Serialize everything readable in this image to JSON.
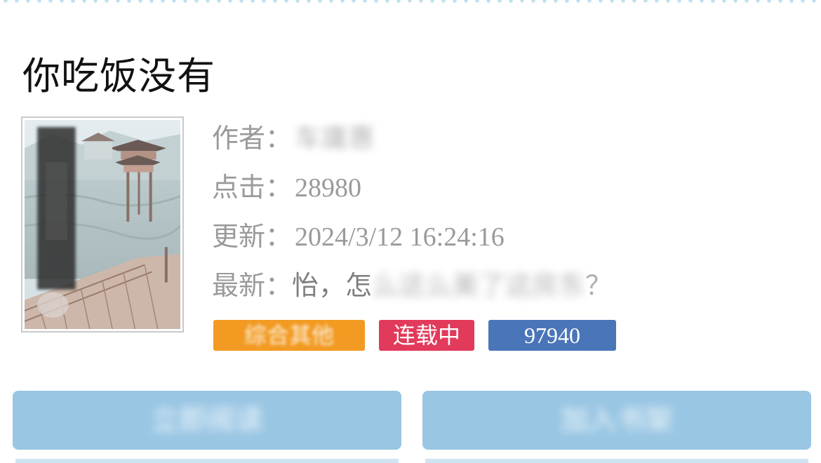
{
  "book": {
    "title": "你吃饭没有",
    "author_label": "作者：",
    "author_value": "车庸惠",
    "clicks_label": "点击：",
    "clicks_value": "28980",
    "updated_label": "更新：",
    "updated_value": "2024/3/12 16:24:16",
    "latest_label": "最新：",
    "latest_value_visible": "怡，怎",
    "latest_value_obscured": "么这么美了这房东",
    "latest_value_end": "？"
  },
  "tags": {
    "category": "综合其他",
    "status": "连载中",
    "word_count": "97940"
  },
  "actions": {
    "read_label": "立即阅读",
    "shelf_label": "加入书架"
  },
  "colors": {
    "category_tag": "#f29a22",
    "status_tag": "#e23a5a",
    "word_tag": "#4a75b8",
    "button_bg": "#99c6e3"
  },
  "icons": {
    "cover": "book-cover-image"
  }
}
